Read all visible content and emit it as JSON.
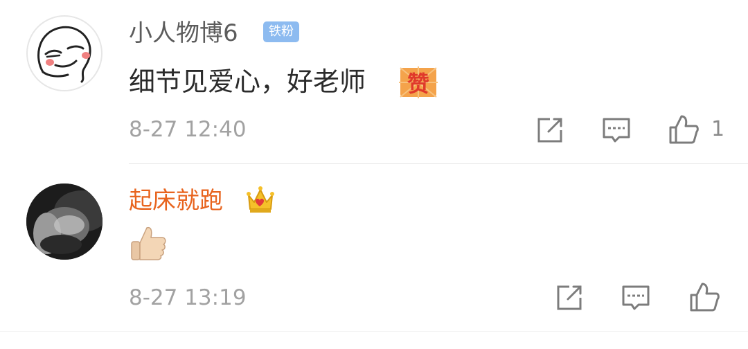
{
  "comments": [
    {
      "username": "小人物博6",
      "badge": "铁粉",
      "text": "细节见爱心，好老师",
      "emoji": "赞",
      "timestamp": "8-27 12:40",
      "like_count": "1"
    },
    {
      "username": "起床就跑",
      "text": "",
      "emoji": "thumbs-up-emoji",
      "timestamp": "8-27 13:19",
      "like_count": ""
    }
  ],
  "icons": {
    "share": "share-icon",
    "reply": "reply-icon",
    "like": "thumbs-up-icon",
    "crown": "crown-icon"
  },
  "colors": {
    "username_default": "#5c5c5c",
    "username_vip": "#e8641e",
    "badge_bg": "#8dbbf0",
    "timestamp": "#a2a2a2",
    "icon": "#7c7c7c",
    "text": "#2b2b2b"
  }
}
